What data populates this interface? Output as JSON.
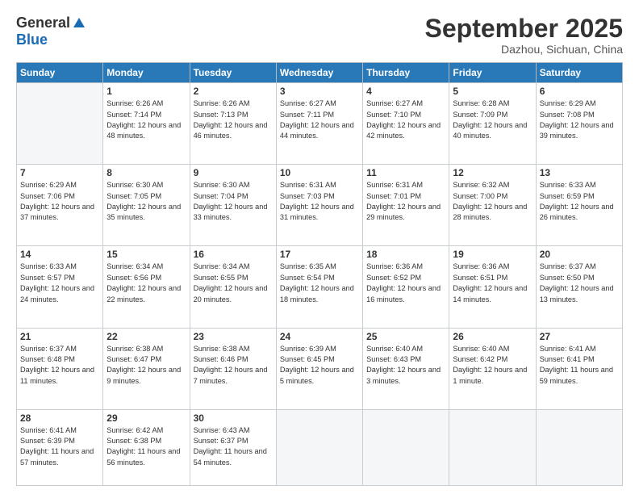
{
  "logo": {
    "general": "General",
    "blue": "Blue"
  },
  "title": "September 2025",
  "subtitle": "Dazhou, Sichuan, China",
  "weekdays": [
    "Sunday",
    "Monday",
    "Tuesday",
    "Wednesday",
    "Thursday",
    "Friday",
    "Saturday"
  ],
  "weeks": [
    [
      {
        "day": "",
        "sunrise": "",
        "sunset": "",
        "daylight": ""
      },
      {
        "day": "1",
        "sunrise": "Sunrise: 6:26 AM",
        "sunset": "Sunset: 7:14 PM",
        "daylight": "Daylight: 12 hours and 48 minutes."
      },
      {
        "day": "2",
        "sunrise": "Sunrise: 6:26 AM",
        "sunset": "Sunset: 7:13 PM",
        "daylight": "Daylight: 12 hours and 46 minutes."
      },
      {
        "day": "3",
        "sunrise": "Sunrise: 6:27 AM",
        "sunset": "Sunset: 7:11 PM",
        "daylight": "Daylight: 12 hours and 44 minutes."
      },
      {
        "day": "4",
        "sunrise": "Sunrise: 6:27 AM",
        "sunset": "Sunset: 7:10 PM",
        "daylight": "Daylight: 12 hours and 42 minutes."
      },
      {
        "day": "5",
        "sunrise": "Sunrise: 6:28 AM",
        "sunset": "Sunset: 7:09 PM",
        "daylight": "Daylight: 12 hours and 40 minutes."
      },
      {
        "day": "6",
        "sunrise": "Sunrise: 6:29 AM",
        "sunset": "Sunset: 7:08 PM",
        "daylight": "Daylight: 12 hours and 39 minutes."
      }
    ],
    [
      {
        "day": "7",
        "sunrise": "Sunrise: 6:29 AM",
        "sunset": "Sunset: 7:06 PM",
        "daylight": "Daylight: 12 hours and 37 minutes."
      },
      {
        "day": "8",
        "sunrise": "Sunrise: 6:30 AM",
        "sunset": "Sunset: 7:05 PM",
        "daylight": "Daylight: 12 hours and 35 minutes."
      },
      {
        "day": "9",
        "sunrise": "Sunrise: 6:30 AM",
        "sunset": "Sunset: 7:04 PM",
        "daylight": "Daylight: 12 hours and 33 minutes."
      },
      {
        "day": "10",
        "sunrise": "Sunrise: 6:31 AM",
        "sunset": "Sunset: 7:03 PM",
        "daylight": "Daylight: 12 hours and 31 minutes."
      },
      {
        "day": "11",
        "sunrise": "Sunrise: 6:31 AM",
        "sunset": "Sunset: 7:01 PM",
        "daylight": "Daylight: 12 hours and 29 minutes."
      },
      {
        "day": "12",
        "sunrise": "Sunrise: 6:32 AM",
        "sunset": "Sunset: 7:00 PM",
        "daylight": "Daylight: 12 hours and 28 minutes."
      },
      {
        "day": "13",
        "sunrise": "Sunrise: 6:33 AM",
        "sunset": "Sunset: 6:59 PM",
        "daylight": "Daylight: 12 hours and 26 minutes."
      }
    ],
    [
      {
        "day": "14",
        "sunrise": "Sunrise: 6:33 AM",
        "sunset": "Sunset: 6:57 PM",
        "daylight": "Daylight: 12 hours and 24 minutes."
      },
      {
        "day": "15",
        "sunrise": "Sunrise: 6:34 AM",
        "sunset": "Sunset: 6:56 PM",
        "daylight": "Daylight: 12 hours and 22 minutes."
      },
      {
        "day": "16",
        "sunrise": "Sunrise: 6:34 AM",
        "sunset": "Sunset: 6:55 PM",
        "daylight": "Daylight: 12 hours and 20 minutes."
      },
      {
        "day": "17",
        "sunrise": "Sunrise: 6:35 AM",
        "sunset": "Sunset: 6:54 PM",
        "daylight": "Daylight: 12 hours and 18 minutes."
      },
      {
        "day": "18",
        "sunrise": "Sunrise: 6:36 AM",
        "sunset": "Sunset: 6:52 PM",
        "daylight": "Daylight: 12 hours and 16 minutes."
      },
      {
        "day": "19",
        "sunrise": "Sunrise: 6:36 AM",
        "sunset": "Sunset: 6:51 PM",
        "daylight": "Daylight: 12 hours and 14 minutes."
      },
      {
        "day": "20",
        "sunrise": "Sunrise: 6:37 AM",
        "sunset": "Sunset: 6:50 PM",
        "daylight": "Daylight: 12 hours and 13 minutes."
      }
    ],
    [
      {
        "day": "21",
        "sunrise": "Sunrise: 6:37 AM",
        "sunset": "Sunset: 6:48 PM",
        "daylight": "Daylight: 12 hours and 11 minutes."
      },
      {
        "day": "22",
        "sunrise": "Sunrise: 6:38 AM",
        "sunset": "Sunset: 6:47 PM",
        "daylight": "Daylight: 12 hours and 9 minutes."
      },
      {
        "day": "23",
        "sunrise": "Sunrise: 6:38 AM",
        "sunset": "Sunset: 6:46 PM",
        "daylight": "Daylight: 12 hours and 7 minutes."
      },
      {
        "day": "24",
        "sunrise": "Sunrise: 6:39 AM",
        "sunset": "Sunset: 6:45 PM",
        "daylight": "Daylight: 12 hours and 5 minutes."
      },
      {
        "day": "25",
        "sunrise": "Sunrise: 6:40 AM",
        "sunset": "Sunset: 6:43 PM",
        "daylight": "Daylight: 12 hours and 3 minutes."
      },
      {
        "day": "26",
        "sunrise": "Sunrise: 6:40 AM",
        "sunset": "Sunset: 6:42 PM",
        "daylight": "Daylight: 12 hours and 1 minute."
      },
      {
        "day": "27",
        "sunrise": "Sunrise: 6:41 AM",
        "sunset": "Sunset: 6:41 PM",
        "daylight": "Daylight: 11 hours and 59 minutes."
      }
    ],
    [
      {
        "day": "28",
        "sunrise": "Sunrise: 6:41 AM",
        "sunset": "Sunset: 6:39 PM",
        "daylight": "Daylight: 11 hours and 57 minutes."
      },
      {
        "day": "29",
        "sunrise": "Sunrise: 6:42 AM",
        "sunset": "Sunset: 6:38 PM",
        "daylight": "Daylight: 11 hours and 56 minutes."
      },
      {
        "day": "30",
        "sunrise": "Sunrise: 6:43 AM",
        "sunset": "Sunset: 6:37 PM",
        "daylight": "Daylight: 11 hours and 54 minutes."
      },
      {
        "day": "",
        "sunrise": "",
        "sunset": "",
        "daylight": ""
      },
      {
        "day": "",
        "sunrise": "",
        "sunset": "",
        "daylight": ""
      },
      {
        "day": "",
        "sunrise": "",
        "sunset": "",
        "daylight": ""
      },
      {
        "day": "",
        "sunrise": "",
        "sunset": "",
        "daylight": ""
      }
    ]
  ]
}
